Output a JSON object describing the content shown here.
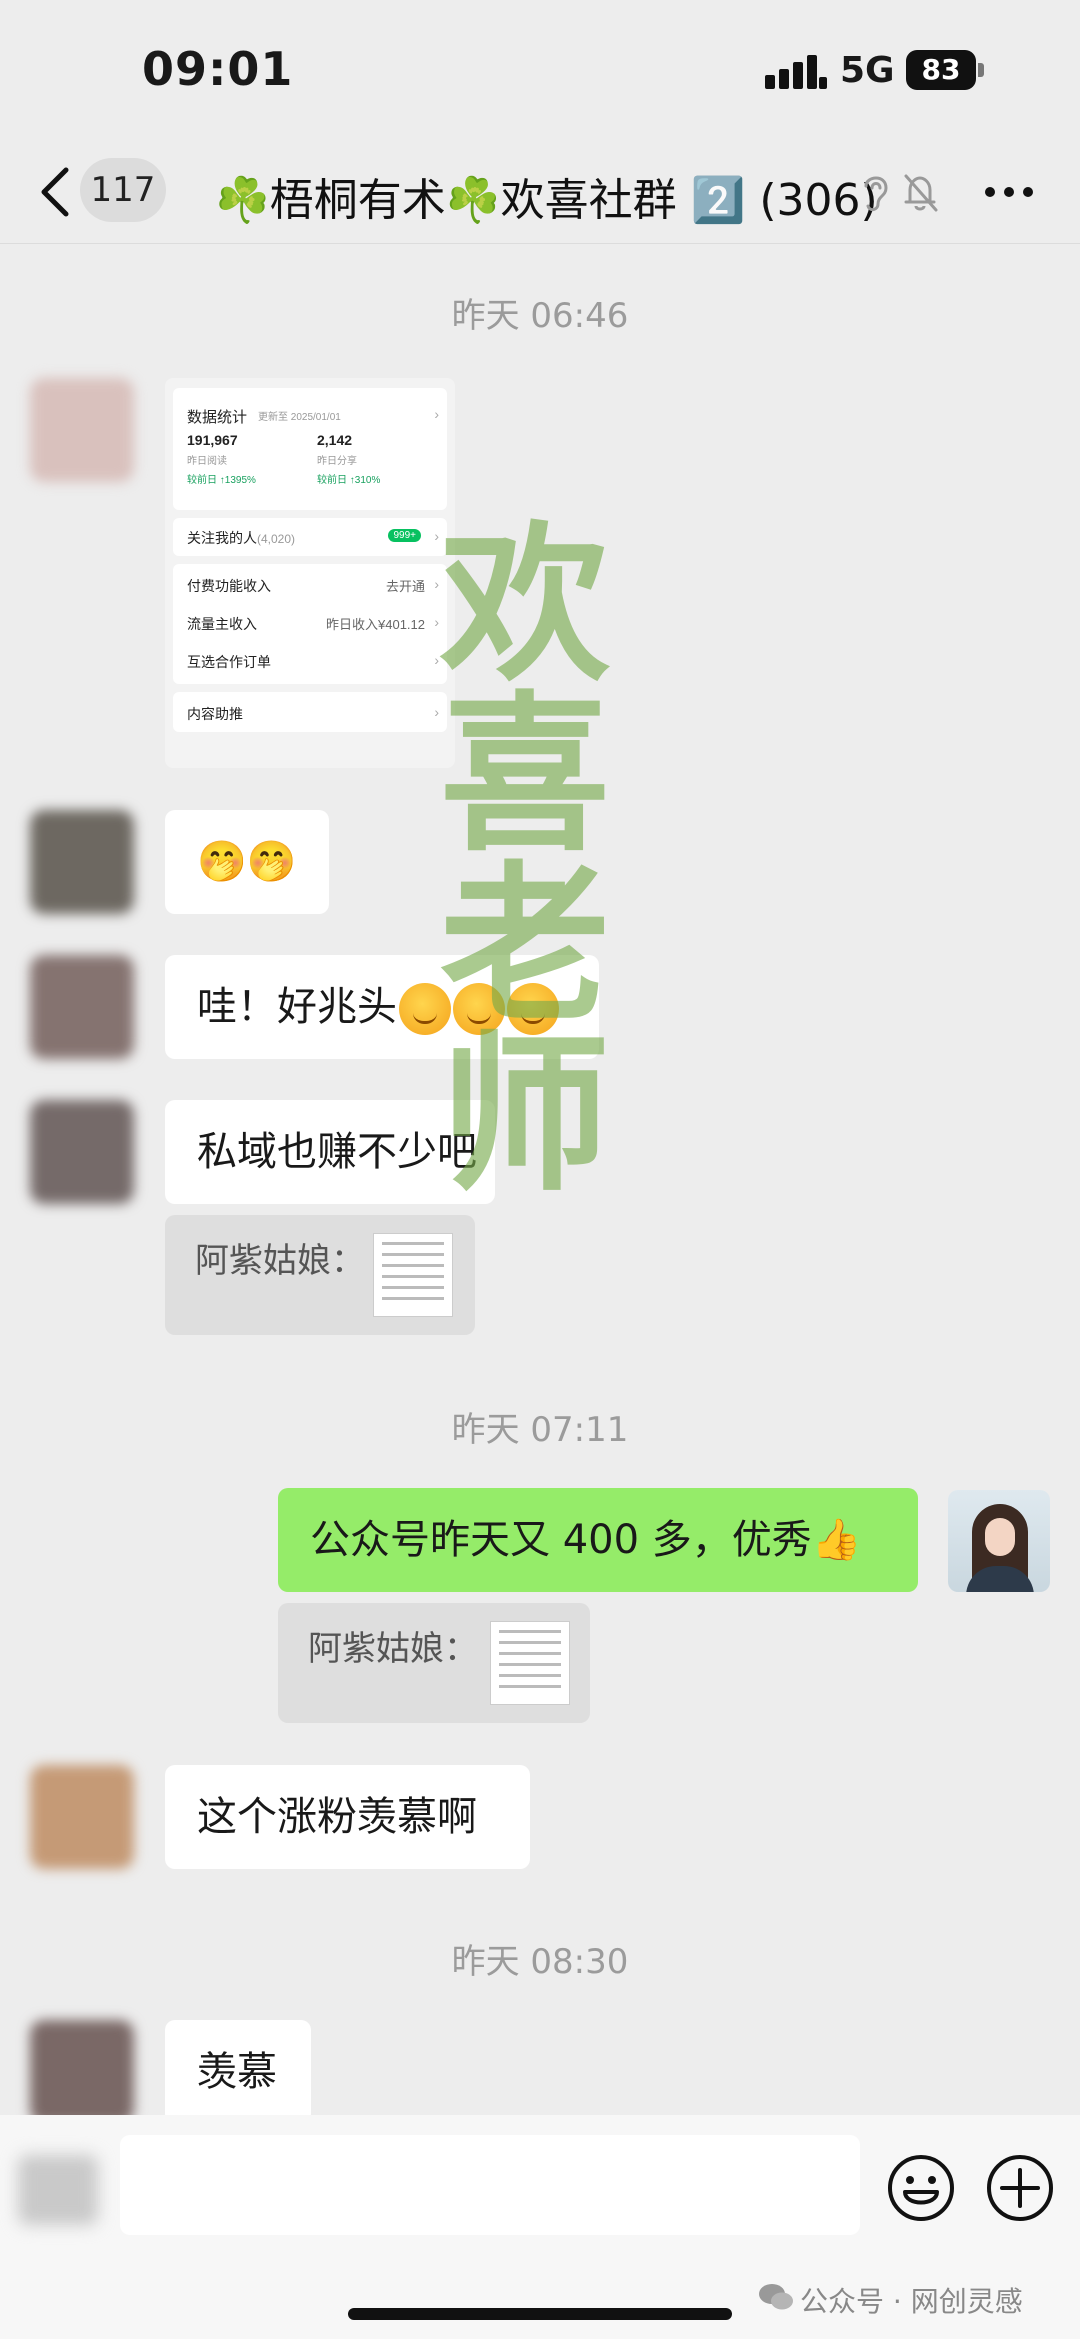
{
  "status_bar": {
    "time": "09:01",
    "network": "5G",
    "battery": "83"
  },
  "nav": {
    "unread_count": "117",
    "title": "☘️梧桐有术☘️欢喜社群 2️⃣ (306)"
  },
  "timestamps": [
    "昨天 06:46",
    "昨天 07:11",
    "昨天 08:30"
  ],
  "stats_card": {
    "title": "数据统计",
    "updated": "更新至 2025/01/01",
    "reads_value": "191,967",
    "reads_label": "昨日阅读",
    "reads_growth": "较前日 ↑1395%",
    "shares_value": "2,142",
    "shares_label": "昨日分享",
    "shares_growth": "较前日 ↑310%",
    "followers_label": "关注我的人",
    "followers_count": "(4,020)",
    "followers_badge": "999+",
    "paid_label": "付费功能收入",
    "paid_action": "去开通",
    "traffic_label": "流量主收入",
    "traffic_value": "昨日收入¥401.12",
    "orders_label": "互选合作订单",
    "content_label": "内容助推"
  },
  "messages": {
    "msg2": "🤭🤭",
    "msg3": "哇！好兆头",
    "msg4": "私域也赚不少吧",
    "quote_label": "阿紫姑娘：",
    "msg5": "公众号昨天又 400 多，优秀👍",
    "msg6": "这个涨粉羡慕啊",
    "msg7": "羡慕"
  },
  "watermark": [
    "欢",
    "喜",
    "老",
    "师"
  ],
  "footer_credit": "公众号 · 网创灵感",
  "icons": [
    "back-icon",
    "ear-icon",
    "mute-bell-icon",
    "more-icon",
    "emoji-icon",
    "plus-icon",
    "wechat-logo-icon"
  ]
}
